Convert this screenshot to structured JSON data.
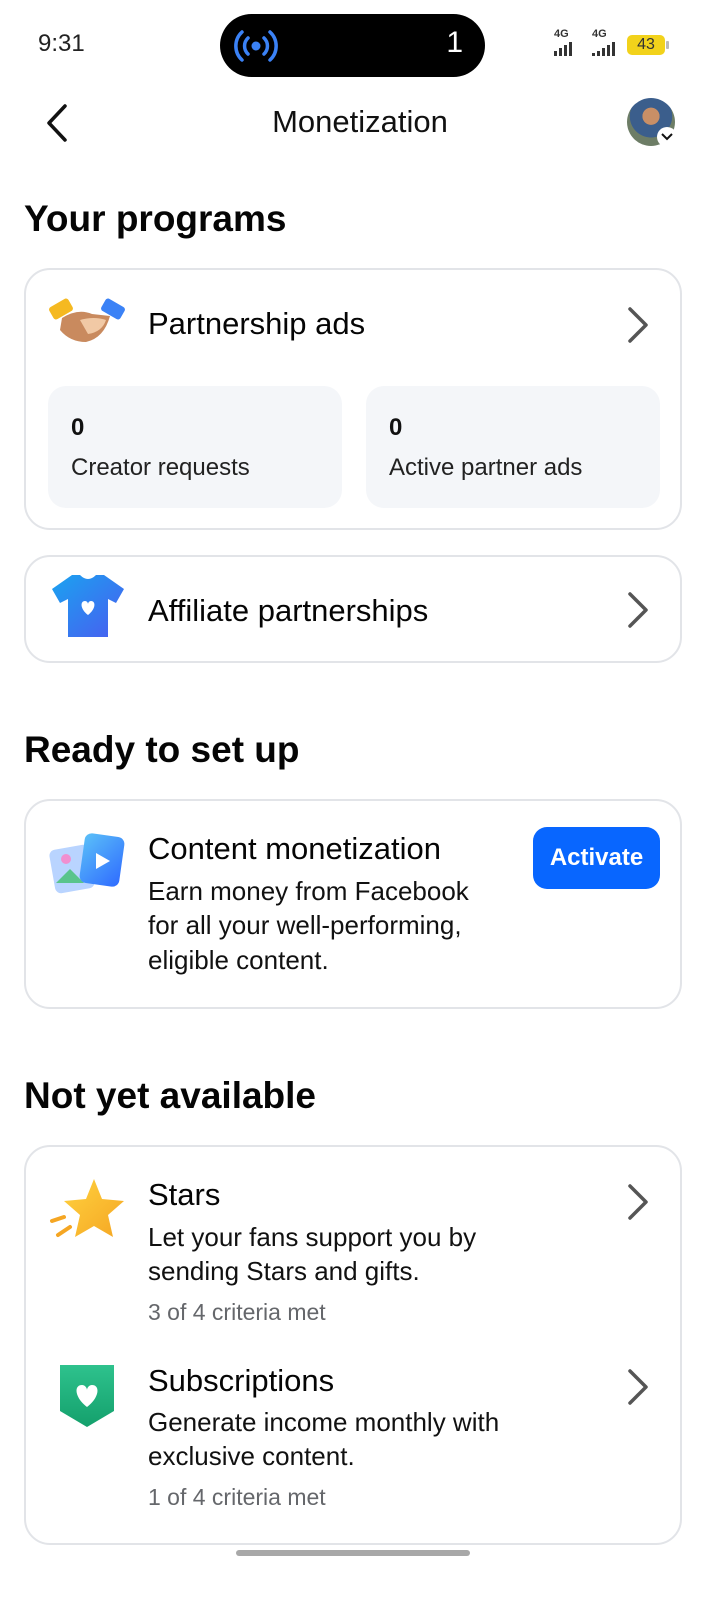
{
  "status": {
    "time": "9:31",
    "island_count": "1",
    "signal1_label": "4G",
    "signal2_label": "4G",
    "battery": "43"
  },
  "header": {
    "title": "Monetization"
  },
  "sections": {
    "programs_title": "Your programs",
    "ready_title": "Ready to set up",
    "unavailable_title": "Not yet available"
  },
  "partnership": {
    "title": "Partnership ads",
    "stats": [
      {
        "value": "0",
        "label": "Creator requests"
      },
      {
        "value": "0",
        "label": "Active partner ads"
      }
    ]
  },
  "affiliate": {
    "title": "Affiliate partnerships"
  },
  "content_monetization": {
    "title": "Content monetization",
    "desc1": "Earn money from Facebook",
    "desc2": "for all your well-performing,",
    "desc3": "eligible content.",
    "button": "Activate"
  },
  "stars": {
    "title": "Stars",
    "desc1": "Let your fans support you by",
    "desc2": "sending Stars and gifts.",
    "criteria": "3 of 4 criteria met"
  },
  "subscriptions": {
    "title": "Subscriptions",
    "desc1": "Generate income monthly with",
    "desc2": "exclusive content.",
    "criteria": "1 of 4 criteria met"
  },
  "colors": {
    "accent": "#0866ff",
    "card_border": "#e2e4e8",
    "stat_bg": "#f4f6f9",
    "battery": "#f2d21b"
  }
}
